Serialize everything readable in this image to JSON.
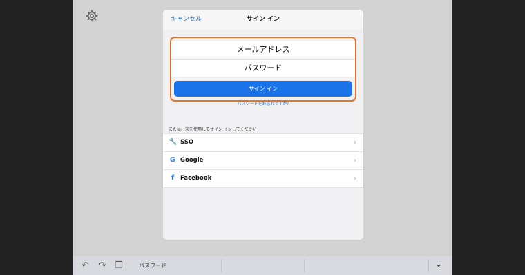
{
  "header": {
    "cancel_label": "キャンセル",
    "title": "サイン イン"
  },
  "form": {
    "email_placeholder": "メールアドレス",
    "password_placeholder": "パスワード",
    "signin_label": "サイン イン",
    "forgot_label": "パスワードをお忘れですか?"
  },
  "alternatives": {
    "label": "または、次を使用してサイン インしてください",
    "items": [
      {
        "label": "SSO",
        "icon": "wrench-icon"
      },
      {
        "label": "Google",
        "icon": "google-icon"
      },
      {
        "label": "Facebook",
        "icon": "facebook-icon"
      }
    ]
  },
  "keyboard_bar": {
    "suggestion": "パスワード"
  },
  "colors": {
    "accent": "#1a73e8",
    "highlight": "#e5742a"
  }
}
